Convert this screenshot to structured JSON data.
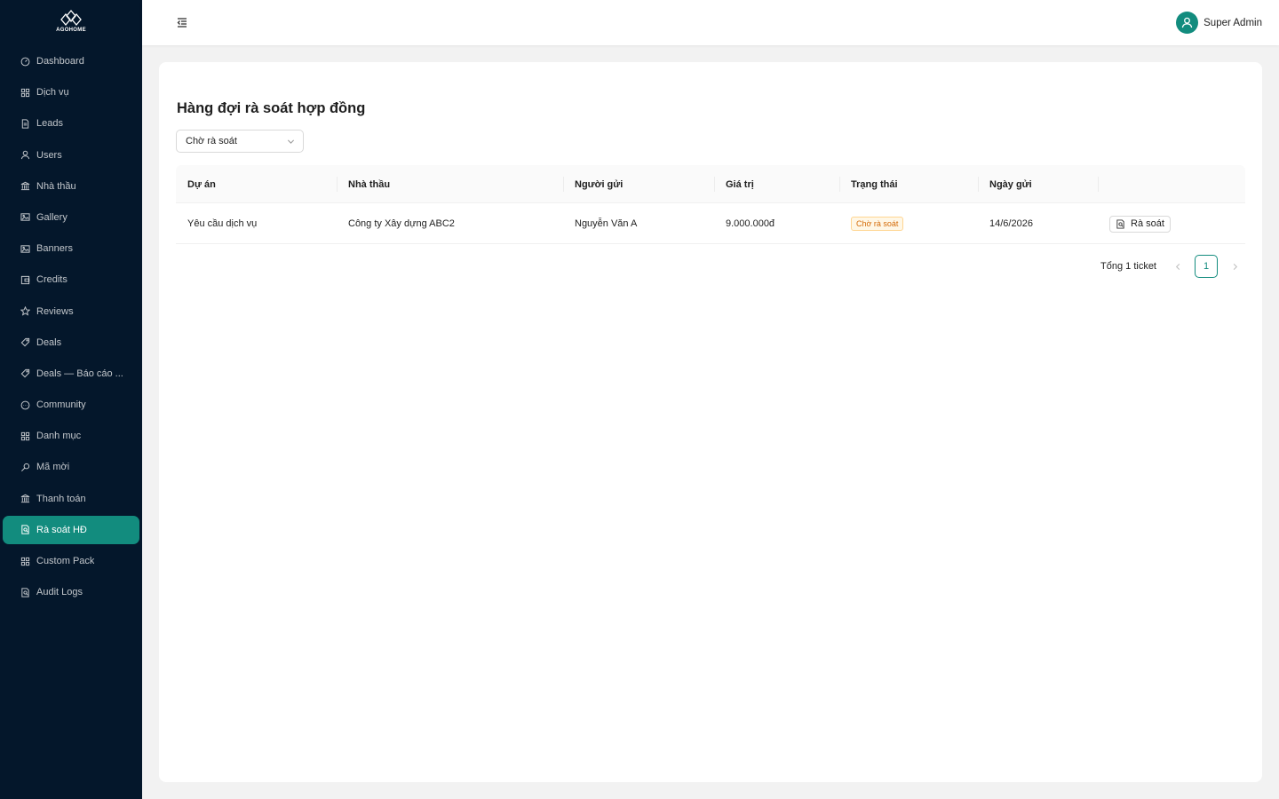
{
  "brand": {
    "name": "AGOHOME"
  },
  "colors": {
    "sidebar_bg": "#04172b",
    "accent": "#128c7e",
    "tag_bg": "#fff7e6",
    "tag_text": "#d46b08"
  },
  "sidebar": {
    "items": [
      {
        "label": "Dashboard",
        "icon": "dashboard-icon"
      },
      {
        "label": "Dịch vụ",
        "icon": "grid-icon"
      },
      {
        "label": "Leads",
        "icon": "file-icon"
      },
      {
        "label": "Users",
        "icon": "user-icon"
      },
      {
        "label": "Nhà thầu",
        "icon": "bank-icon"
      },
      {
        "label": "Gallery",
        "icon": "picture-icon"
      },
      {
        "label": "Banners",
        "icon": "picture-icon"
      },
      {
        "label": "Credits",
        "icon": "wallet-icon"
      },
      {
        "label": "Reviews",
        "icon": "star-icon"
      },
      {
        "label": "Deals",
        "icon": "tag-icon"
      },
      {
        "label": "Deals — Báo cáo ...",
        "icon": "tag-icon"
      },
      {
        "label": "Community",
        "icon": "message-icon"
      },
      {
        "label": "Danh mục",
        "icon": "grid-icon"
      },
      {
        "label": "Mã mời",
        "icon": "key-icon"
      },
      {
        "label": "Thanh toán",
        "icon": "bank-icon"
      },
      {
        "label": "Rà soát HĐ",
        "icon": "file-search-icon",
        "active": true
      },
      {
        "label": "Custom Pack",
        "icon": "grid-icon"
      },
      {
        "label": "Audit Logs",
        "icon": "file-search-icon"
      }
    ]
  },
  "header": {
    "user_name": "Super Admin"
  },
  "main": {
    "title": "Hàng đợi rà soát hợp đồng",
    "filter": {
      "selected": "Chờ rà soát"
    },
    "table": {
      "columns": [
        "Dự án",
        "Nhà thầu",
        "Người gửi",
        "Giá trị",
        "Trạng thái",
        "Ngày gửi",
        ""
      ],
      "rows": [
        {
          "project": "Yêu cầu dịch vụ",
          "contractor": "Công ty Xây dựng ABC2",
          "sender": "Nguyễn Văn A",
          "value": "9.000.000đ",
          "status": "Chờ rà soát",
          "date": "14/6/2026",
          "action": "Rà soát"
        }
      ]
    },
    "pagination": {
      "total_text": "Tổng 1 ticket",
      "current_page": "1"
    }
  }
}
